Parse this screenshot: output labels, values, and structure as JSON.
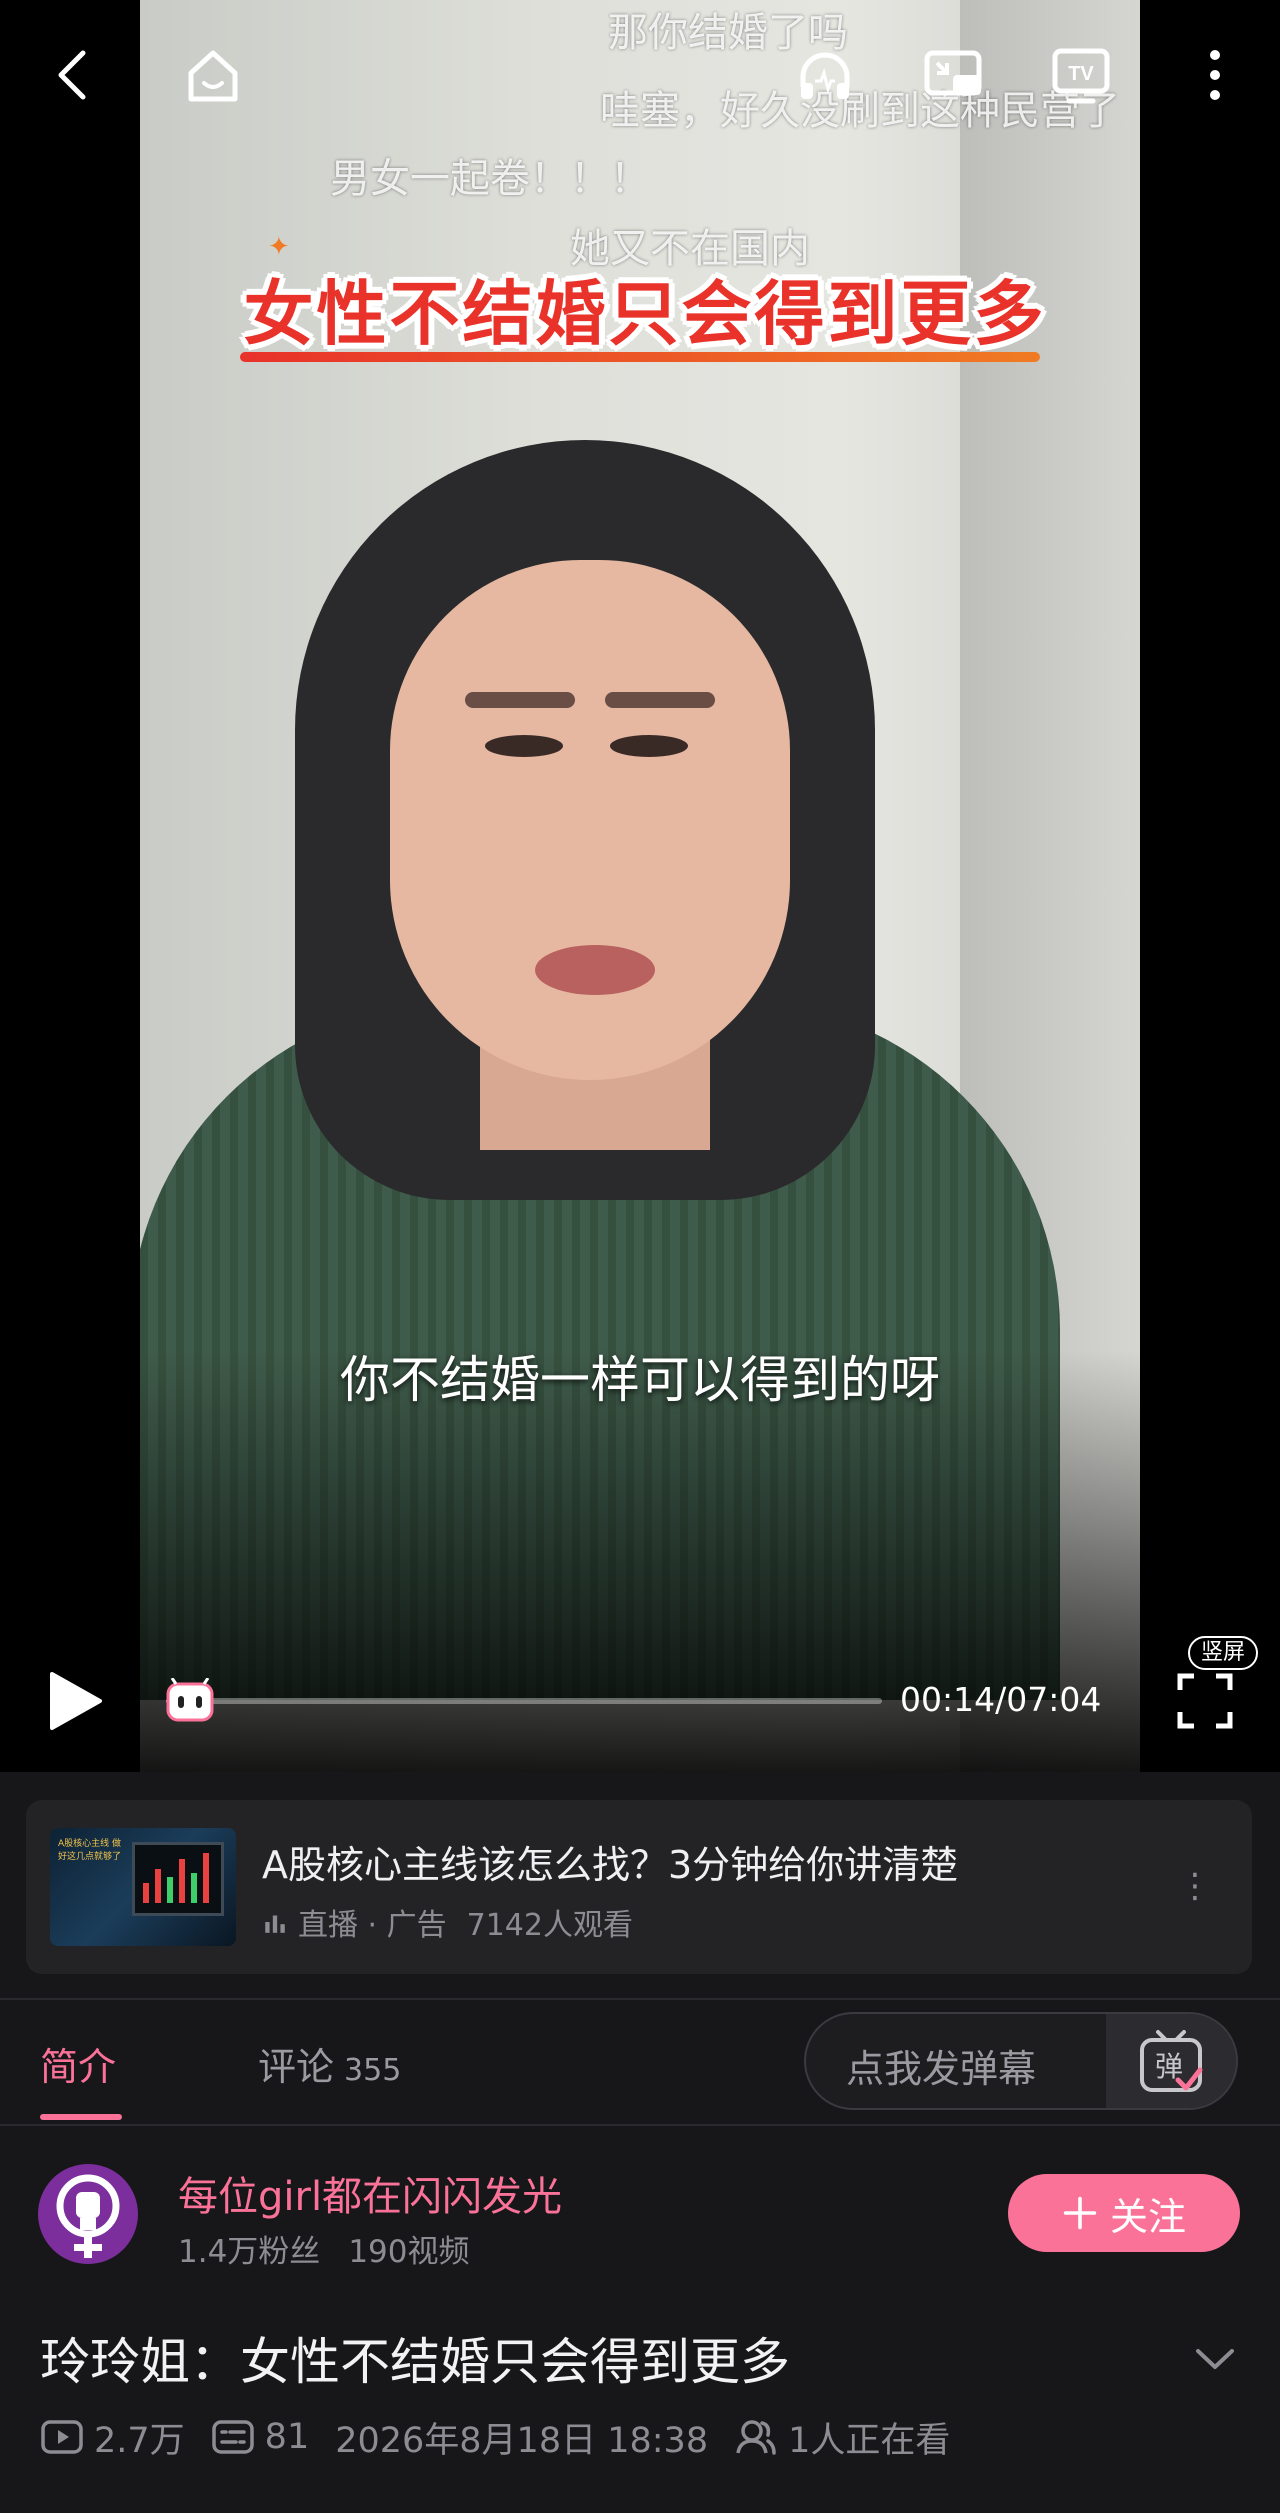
{
  "video": {
    "banner_title": "女性不结婚只会得到更多",
    "subtitle": "你不结婚一样可以得到的呀",
    "danmaku": [
      "那你结婚了吗",
      "哇塞，好久没刷到这种民营了",
      "男女一起卷！！！",
      "她又不在国内"
    ],
    "time": "00:14/07:04",
    "progress": 0.033,
    "vertical_badge": "竖屏"
  },
  "ad": {
    "title": "A股核心主线该怎么找？3分钟给你讲清楚",
    "meta_label": "直播 · 广告",
    "viewers": "7142人观看",
    "thumb_text": "A股核心主线 做好这几点就够了"
  },
  "tabs": {
    "intro": "简介",
    "comments": "评论",
    "comments_count": "355",
    "danmu_placeholder": "点我发弹幕"
  },
  "uploader": {
    "name": "每位girl都在闪闪发光",
    "fans": "1.4万粉丝",
    "videos": "190视频",
    "follow_label": "关注"
  },
  "details": {
    "title": "玲玲姐：女性不结婚只会得到更多",
    "views": "2.7万",
    "danmaku_count": "81",
    "date": "2026年8月18日 18:38",
    "watching": "1人正在看"
  },
  "colors": {
    "accent": "#fb7299",
    "background": "#17171a",
    "card": "#232326"
  }
}
